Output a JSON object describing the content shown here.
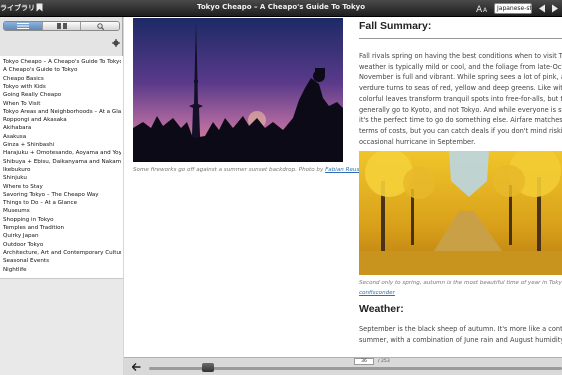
{
  "titlebar": {
    "library_label": "ライブラリ",
    "book_title": "Tokyo Cheapo – A Cheapo's Guide To Tokyo",
    "font_button_label": "AA",
    "language_select_value": "Japanese-style"
  },
  "sidebar": {
    "toc_items": [
      "Tokyo Cheapo – A Cheapo's Guide To Tokyo",
      "A Cheapo's Guide to Tokyo",
      "Cheapo Basics",
      "Tokyo with Kids",
      "Going Really Cheapo",
      "When To Visit",
      "Tokyo Areas and Neighborhoods – At a Glance",
      "Roppongi and Akasaka",
      "Akihabara",
      "Asakusa",
      "Ginza + Shinbashi",
      "Harajuku + Omotesando, Aoyama and Yoyogi",
      "Shibuya + Ebisu, Daikanyama and Nakameguro",
      "Ikebukuro",
      "Shinjuku",
      "Where to Stay",
      "Savoring Tokyo – The Cheapo Way",
      "Things to Do – At a Glance",
      "Museums",
      "Shopping in Tokyo",
      "Temples and Tradition",
      "Quirky Japan",
      "Outdoor Tokyo",
      "Architecture, Art and Contemporary Culture",
      "Seasonal Events",
      "Nightlife"
    ]
  },
  "content": {
    "photo1_caption": "Some fireworks go off against a summer sunset backdrop. Photo by ",
    "photo1_credit": "Fabian Reus",
    "fall_heading": "Fall Summary:",
    "fall_lines": [
      "Fall rivals spring on having the best conditions when to visit Tokyo",
      "weather is typically mild or cool, and the foliage from late-October thr",
      "November is full and vibrant. While spring sees a lot of pink, aut",
      "verdure turns to seas of red, yellow and deep greens. Like with sakura",
      "colorful leaves transform tranquil spots into free-for-alls, but the cro",
      "generally go to Kyoto, and not Tokyo. And while everyone is staring at t",
      "it's the perfect time to go do something else. Airfare matches sprin",
      "terms of costs, but you can catch deals if you don't mind risking",
      "occasional hurricane in September."
    ],
    "photo2_caption_line1": "Second only to spring, autumn is the most beautiful time of year in Tokyo. Pho",
    "photo2_credit": "confisconder",
    "weather_heading": "Weather:",
    "weather_lines": [
      "September is the black sheep of autumn. It's more like a continuatio",
      "summer, with a combination of June rain and August humidity. Oc"
    ]
  },
  "bottombar": {
    "current_page": "36",
    "total_pages": "/ 253",
    "progress_fraction": 0.142
  },
  "colors": {
    "accent": "#5d89bb",
    "link": "#2f6db3",
    "titlebar": "#2a2a2a"
  },
  "icons": [
    "bookmark-icon",
    "font-size-icon",
    "prev-page-icon",
    "next-page-icon",
    "toc-icon",
    "thumbnails-icon",
    "search-icon",
    "settings-icon",
    "back-icon"
  ]
}
